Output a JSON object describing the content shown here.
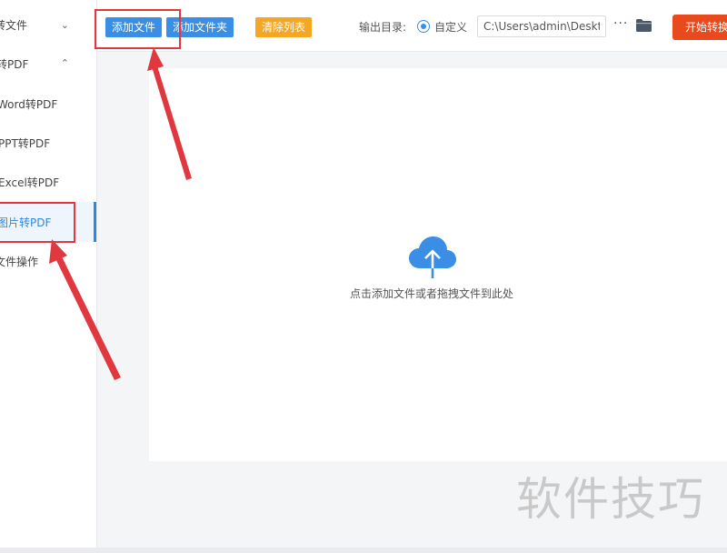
{
  "sidebar": {
    "items": [
      {
        "label": "转文件",
        "chevron": "chevron-down",
        "kind": "group"
      },
      {
        "label": "转PDF",
        "chevron": "chevron-up",
        "kind": "group"
      },
      {
        "label": "Word转PDF",
        "kind": "item"
      },
      {
        "label": "PPT转PDF",
        "kind": "item"
      },
      {
        "label": "Excel转PDF",
        "kind": "item"
      },
      {
        "label": "图片转PDF",
        "kind": "item",
        "active": true
      },
      {
        "label": "文件操作",
        "chevron": "chevron-down",
        "kind": "group"
      }
    ]
  },
  "toolbar": {
    "add_file": "添加文件",
    "add_folder": "添加文件夹",
    "clear_list": "清除列表",
    "output_label": "输出目录:",
    "custom_option": "自定义",
    "path_value": "C:\\Users\\admin\\Deskto",
    "more": "···",
    "start": "开始转换"
  },
  "drop_zone": {
    "hint": "点击添加文件或者拖拽文件到此处",
    "icon": "cloud-upload-icon"
  },
  "watermark": "软件技巧",
  "colors": {
    "accent": "#3a8ee6",
    "orange": "#f5a623",
    "start": "#e84a1e",
    "highlight": "#e0383e",
    "active_bg": "#eef5fd"
  }
}
